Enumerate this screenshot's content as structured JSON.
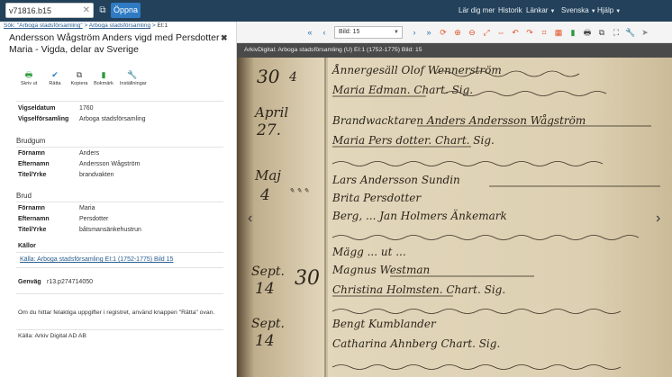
{
  "topbar": {
    "search_value": "v71816.b15",
    "search_placeholder": "",
    "open_label": "Öppna",
    "nav": [
      "Lär dig mer",
      "Historik",
      "Länkar",
      "Svenska",
      "Hjälp"
    ]
  },
  "panel": {
    "breadcrumb_prefix": "Sök:",
    "breadcrumb_link1": "Sök: \"Arboga stadsförsamling\"",
    "breadcrumb_link2": "Arboga stadsförsamling",
    "breadcrumb_tail": "Et:1",
    "title": "Andersson Wågström Anders vigd med Persdotter Maria - Vigda, delar av Sverige",
    "actions": [
      "Skriv ut",
      "Rätta",
      "Kopiera",
      "Bokmärk",
      "Inställningar"
    ],
    "marriage": [
      {
        "key": "Vigseldatum",
        "value": "1760"
      },
      {
        "key": "Vigselförsamling",
        "value": "Arboga stadsförsamling"
      }
    ],
    "groom_heading": "Brudgum",
    "groom": [
      {
        "key": "Förnamn",
        "value": "Anders"
      },
      {
        "key": "Efternamn",
        "value": "Andersson Wågström"
      },
      {
        "key": "Titel/Yrke",
        "value": "brandvakten"
      }
    ],
    "bride_heading": "Brud",
    "bride": [
      {
        "key": "Förnamn",
        "value": "Maria"
      },
      {
        "key": "Efternamn",
        "value": "Persdotter"
      },
      {
        "key": "Titel/Yrke",
        "value": "båtsmansänkehustrun"
      }
    ],
    "sources_heading": "Källor",
    "source_link": "Källa: Arboga stadsförsamling EI:1 (1752-1775) Bild 15",
    "genvag_key": "Genväg",
    "genvag_value": "r13.p274714050",
    "note": "Om du hittar felaktiga uppgifter i registret, använd knappen \"Rätta\" ovan.",
    "source_text": "Källa: Arkiv Digital AD AB"
  },
  "viewer": {
    "page_select": "Bild: 15",
    "caption": "ArkivDigital: Arboga stadsförsamling (U) EI:1 (1752-1775) Bild: 15",
    "lines": [
      "Ånnergesäll Olof Wennerström",
      "Maria Edman. Chart. Sig.",
      "Brandwacktaren Anders Andersson Wågström",
      "Maria Pers dotter. Chart. Sig.",
      "Lars Andersson Sundin",
      "Brita Persdotter",
      "Berg, ... Jan Holmers Änkemark",
      "Mägg ... ut ...",
      "Magnus Westman",
      "Christina Holmsten. Chart. Sig.",
      "Bengt Kumblander",
      "Catharina Ahnberg Chart. Sig."
    ],
    "margin": [
      "30",
      "4",
      "April",
      "27.",
      "Maj",
      "4",
      "Sept.",
      "14",
      "30",
      "Sept.",
      "14",
      "Sept.",
      "14"
    ]
  }
}
